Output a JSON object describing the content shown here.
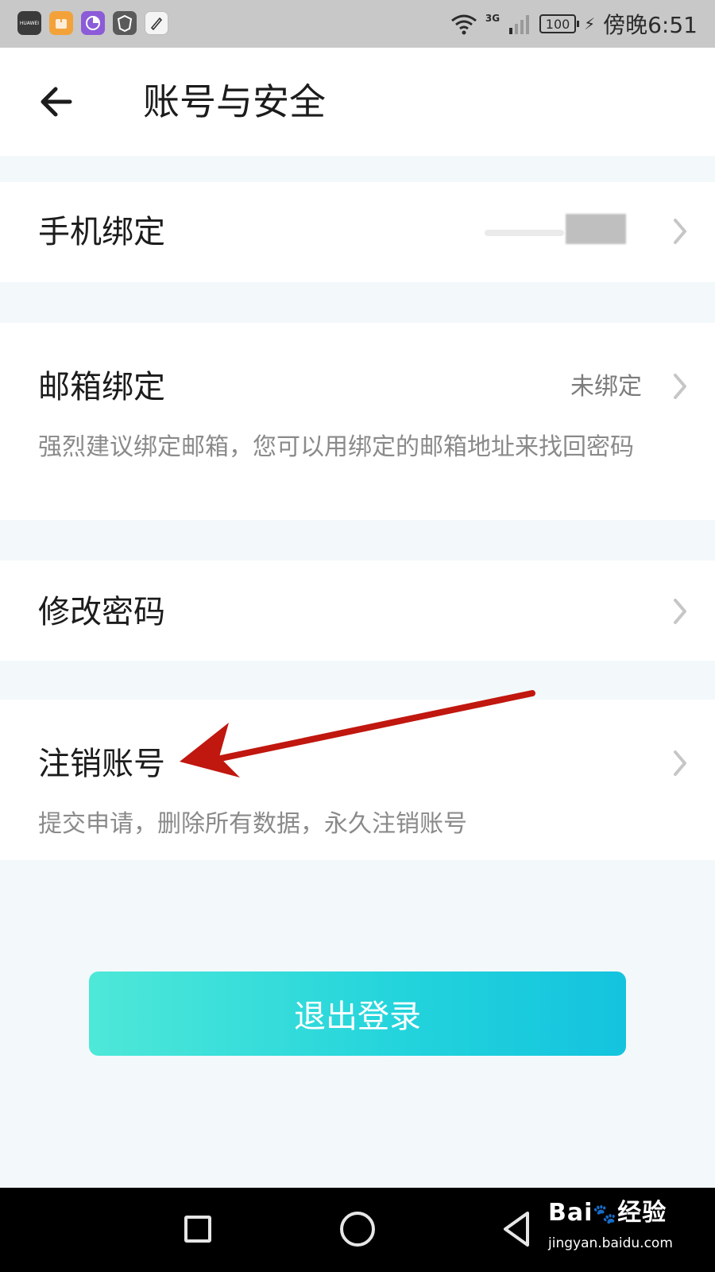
{
  "status_bar": {
    "app_icons": [
      "huawei-icon",
      "package-icon",
      "chart-app-icon",
      "shield-app-icon",
      "pen-app-icon"
    ],
    "huawei_label": "HUAWEI",
    "network_label": "3G",
    "battery_level": "100",
    "time": "傍晚6:51"
  },
  "header": {
    "title": "账号与安全",
    "back_icon": "arrow-left-icon"
  },
  "rows": {
    "phone": {
      "title": "手机绑定",
      "value_redacted": true
    },
    "email": {
      "title": "邮箱绑定",
      "value": "未绑定",
      "description": "强烈建议绑定邮箱，您可以用绑定的邮箱地址来找回密码"
    },
    "password": {
      "title": "修改密码"
    },
    "deactivate": {
      "title": "注销账号",
      "description": "提交申请，删除所有数据，永久注销账号"
    }
  },
  "logout": {
    "label": "退出登录",
    "gradient_start": "#4ee8d8",
    "gradient_end": "#14c3de"
  },
  "annotation": {
    "color": "#c0170f",
    "target": "注销账号"
  },
  "nav_bar": {
    "recent_icon": "square-icon",
    "home_icon": "circle-icon",
    "back_icon": "triangle-back-icon"
  },
  "watermark": {
    "brand": "Bai",
    "brand_suffix": "经验",
    "url": "jingyan.baidu.com"
  },
  "colors": {
    "background": "#f3f8fb",
    "card": "#ffffff",
    "text_primary": "#1c1c1c",
    "text_secondary": "#8a8a8a",
    "chevron": "#c6c6c6"
  }
}
